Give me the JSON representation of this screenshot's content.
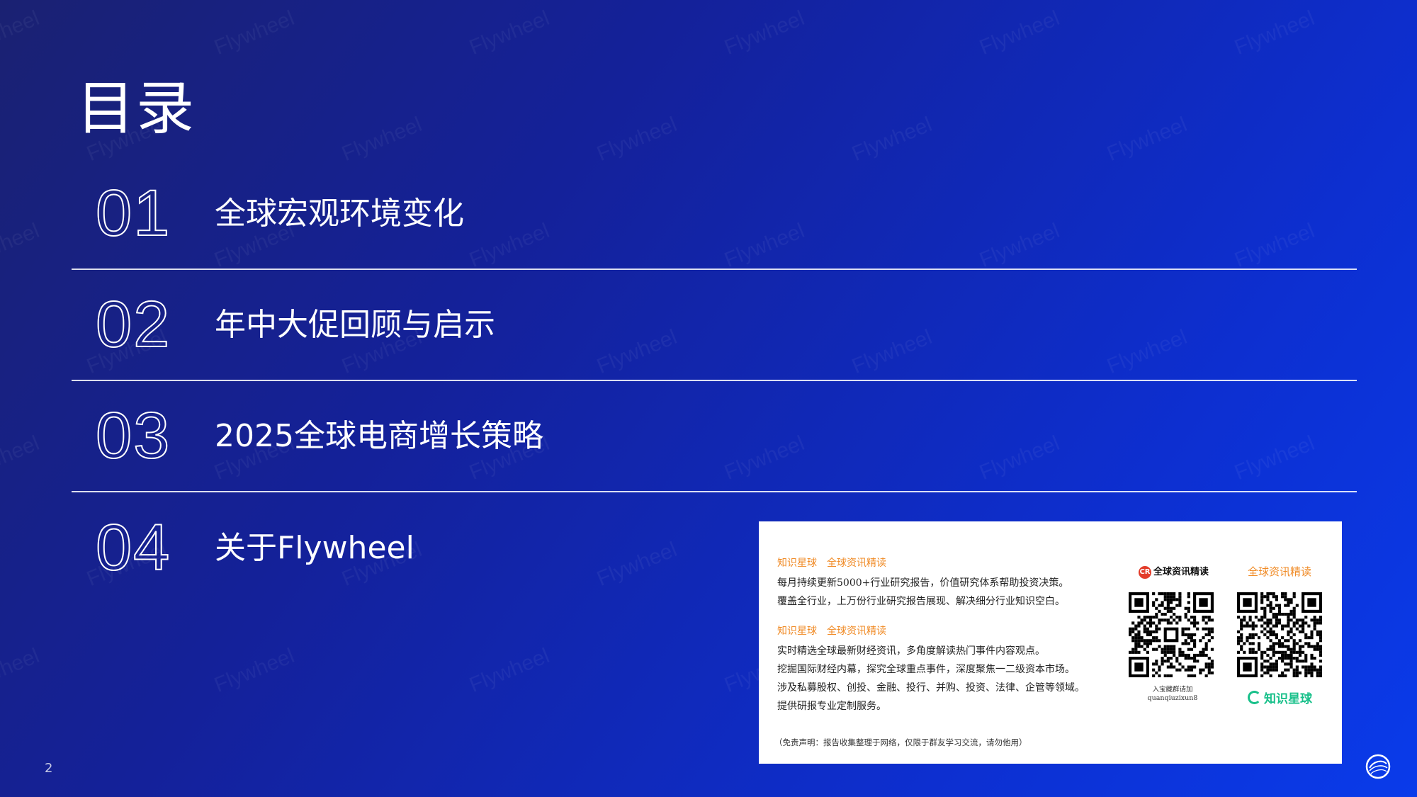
{
  "slide": {
    "title": "目录",
    "page_number": "2",
    "watermark_text": "Flywheel"
  },
  "toc": [
    {
      "number": "01",
      "label": "全球宏观环境变化"
    },
    {
      "number": "02",
      "label": "年中大促回顾与启示"
    },
    {
      "number": "03",
      "label": "2025全球电商增长策略"
    },
    {
      "number": "04",
      "label": "关于Flywheel"
    }
  ],
  "ad": {
    "block1_heading": "知识星球　全球资讯精读",
    "block1_lines": [
      "每月持续更新5000+行业研究报告，价值研究体系帮助投资决策。",
      "覆盖全行业，上万份行业研究报告展现、解决细分行业知识空白。"
    ],
    "block2_heading": "知识星球　全球资讯精读",
    "block2_lines": [
      "实时精选全球最新财经资讯，多角度解读热门事件内容观点。",
      "挖掘国际财经内幕，探究全球重点事件，深度聚焦一二级资本市场。",
      "涉及私募股权、创投、金融、投行、并购、投资、法律、企管等领域。",
      "提供研报专业定制服务。"
    ],
    "disclaimer": "（免责声明：报告收集整理于网络，仅限于群友学习交流，请勿他用）",
    "left_brand_badge": "CR",
    "left_brand": "全球资讯精读",
    "left_caption_1": "入宝藏群请加",
    "left_caption_2": "quanqiuzixun8",
    "right_brand_top": "全球资讯精读",
    "right_brand_bottom": "知识星球"
  },
  "colors": {
    "bg_start": "#1a2172",
    "bg_end": "#0a3bea",
    "accent_orange": "#f08a24",
    "accent_green": "#18c08a"
  }
}
